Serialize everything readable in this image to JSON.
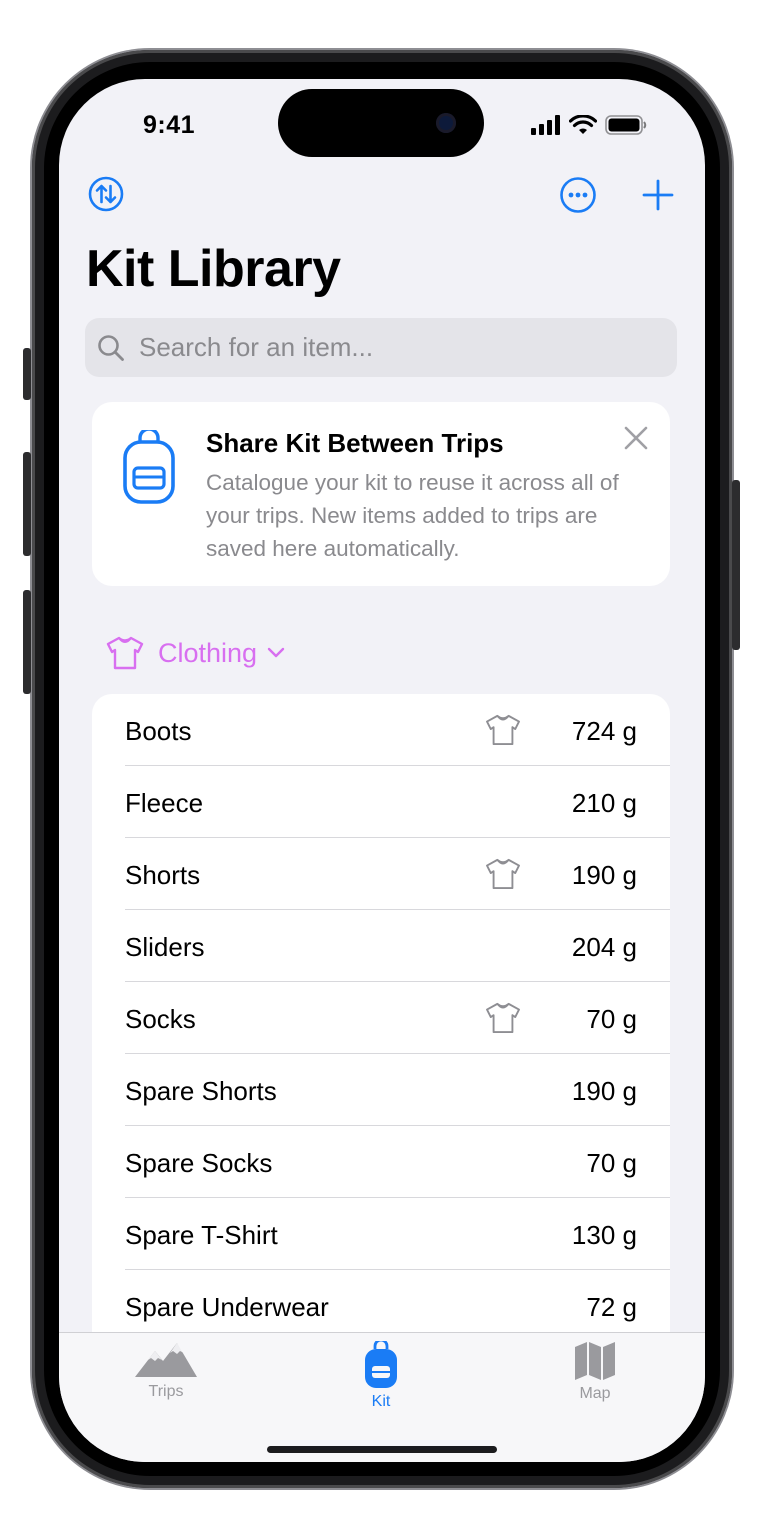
{
  "status": {
    "time": "9:41"
  },
  "nav": {
    "title": "Kit Library"
  },
  "search": {
    "placeholder": "Search for an item..."
  },
  "tip": {
    "title": "Share Kit Between Trips",
    "body": "Catalogue your kit to reuse it across all of your trips. New items added to trips are saved here automatically."
  },
  "category": {
    "label": "Clothing",
    "color": "#d86ff0"
  },
  "items": [
    {
      "name": "Boots",
      "weight": "724 g",
      "worn": true
    },
    {
      "name": "Fleece",
      "weight": "210 g",
      "worn": false
    },
    {
      "name": "Shorts",
      "weight": "190 g",
      "worn": true
    },
    {
      "name": "Sliders",
      "weight": "204 g",
      "worn": false
    },
    {
      "name": "Socks",
      "weight": "70 g",
      "worn": true
    },
    {
      "name": "Spare Shorts",
      "weight": "190 g",
      "worn": false
    },
    {
      "name": "Spare Socks",
      "weight": "70 g",
      "worn": false
    },
    {
      "name": "Spare T-Shirt",
      "weight": "130 g",
      "worn": false
    },
    {
      "name": "Spare Underwear",
      "weight": "72 g",
      "worn": false
    }
  ],
  "tabs": [
    {
      "label": "Trips",
      "icon": "mountains-icon",
      "active": false
    },
    {
      "label": "Kit",
      "icon": "backpack-icon",
      "active": true
    },
    {
      "label": "Map",
      "icon": "map-icon",
      "active": false
    }
  ],
  "colors": {
    "accent": "#1a7cf5",
    "inactive": "#9a9a9e"
  }
}
